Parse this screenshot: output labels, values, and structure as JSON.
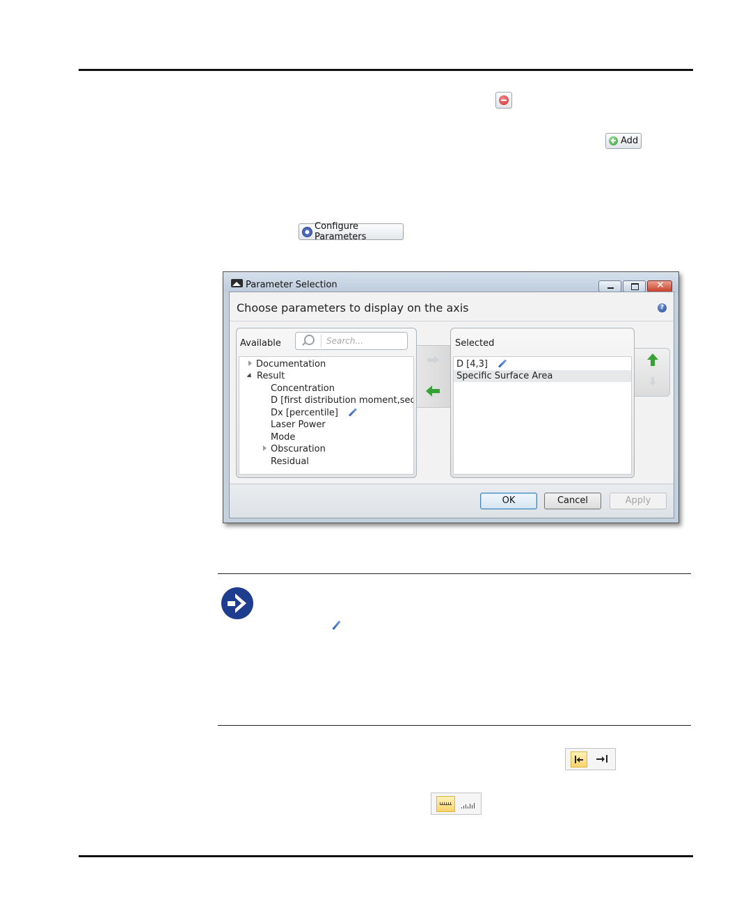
{
  "inline_buttons": {
    "add_label": "Add",
    "configure_label": "Configure Parameters"
  },
  "dialog": {
    "title": "Parameter Selection",
    "heading": "Choose parameters to display on the axis",
    "available_label": "Available",
    "search_placeholder": "Search...",
    "available_items": [
      {
        "label": "Documentation",
        "expander": "collapsed"
      },
      {
        "label": "Result",
        "expander": "expanded"
      },
      {
        "label": "Concentration"
      },
      {
        "label": "D [first distribution moment,seconc"
      },
      {
        "label": "Dx [percentile]",
        "editable": true
      },
      {
        "label": "Laser Power"
      },
      {
        "label": "Mode"
      },
      {
        "label": "Obscuration",
        "expander": "collapsed"
      },
      {
        "label": "Residual"
      }
    ],
    "selected_label": "Selected",
    "selected_items": [
      {
        "label": "D [4,3]",
        "editable": true
      },
      {
        "label": "Specific Surface Area",
        "highlighted": true
      }
    ],
    "buttons": {
      "ok": "OK",
      "cancel": "Cancel",
      "apply": "Apply"
    }
  },
  "toolbar_icons": {
    "align": [
      "align-left-icon",
      "align-right-icon"
    ],
    "bars": [
      "bar-labels-icon",
      "bar-chart-icon"
    ]
  },
  "colors": {
    "accent_blue": "#1f3d8f",
    "arrow_green": "#3aa63a",
    "remove_red": "#d83a3a"
  }
}
